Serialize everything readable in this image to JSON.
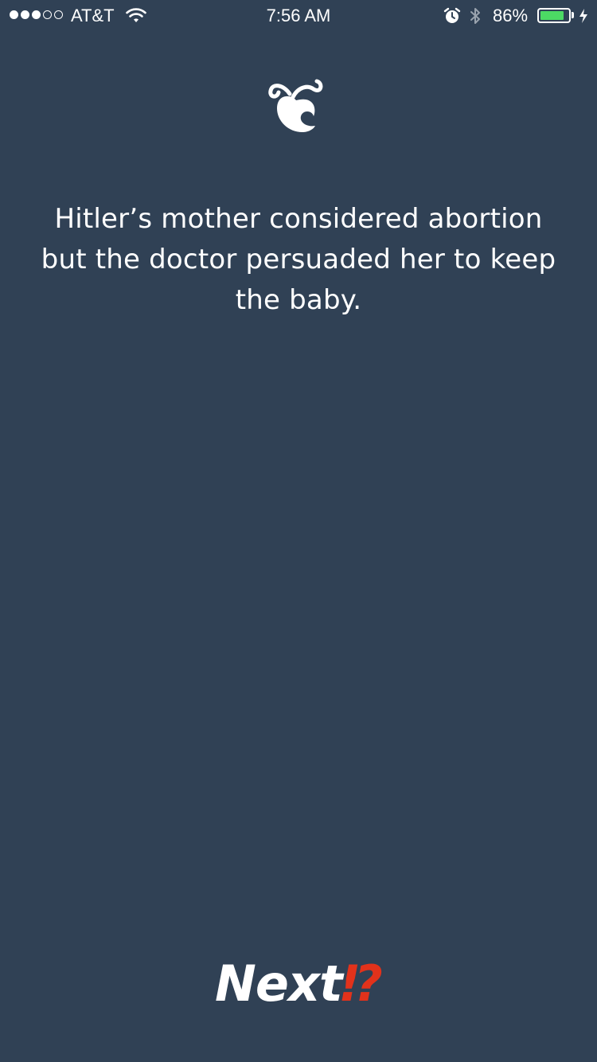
{
  "status_bar": {
    "carrier": "AT&T",
    "signal_bars_filled": 3,
    "signal_bars_total": 5,
    "time": "7:56 AM",
    "battery_percent": "86%",
    "battery_level": 0.86,
    "icons": [
      "wifi-icon",
      "alarm-icon",
      "bluetooth-icon",
      "battery-icon",
      "charging-icon"
    ]
  },
  "logo": {
    "icon": "apple-swirl-logo"
  },
  "fact": {
    "text": "Hitler’s mother considered abortion but the doctor persuaded her to keep the baby."
  },
  "next_button": {
    "label": "Next",
    "mark": "⁉"
  },
  "colors": {
    "background": "#304155",
    "text": "#ffffff",
    "accent": "#e2321b",
    "battery": "#4cd964"
  }
}
